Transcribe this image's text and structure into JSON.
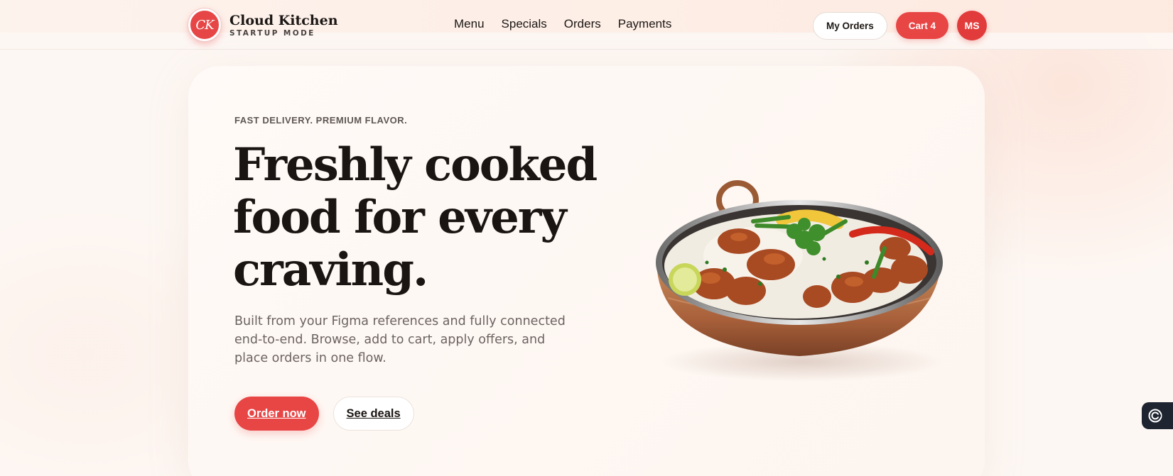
{
  "brand": {
    "logo_text": "CK",
    "name": "Cloud Kitchen",
    "tagline": "STARTUP MODE"
  },
  "nav": {
    "links": [
      "Menu",
      "Specials",
      "Orders",
      "Payments"
    ],
    "my_orders_label": "My Orders",
    "cart_label": "Cart 4",
    "avatar_initials": "MS"
  },
  "hero": {
    "eyebrow": "FAST DELIVERY. PREMIUM FLAVOR.",
    "headline": "Freshly cooked food for every craving.",
    "subtext": "Built from your Figma references and fully connected end-to-end. Browse, add to cart, apply offers, and place orders in one flow.",
    "primary_cta": "Order now",
    "secondary_cta": "See deals"
  },
  "colors": {
    "accent": "#e84545",
    "background": "#fdf7f3",
    "text": "#1a1512"
  },
  "icons": {
    "help_fab": "support-icon"
  }
}
